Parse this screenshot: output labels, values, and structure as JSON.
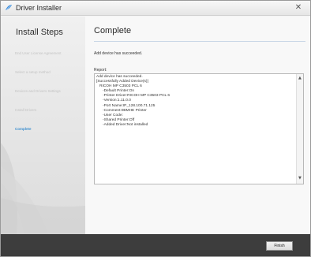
{
  "window": {
    "title": "Driver Installer",
    "close_glyph": "✕",
    "icon": "driver-installer-icon",
    "accent_color": "#3c8fcf"
  },
  "sidebar": {
    "title": "Install Steps",
    "steps": [
      {
        "label": "End User License Agreement",
        "state": "done"
      },
      {
        "label": "Select a setup method",
        "state": "done"
      },
      {
        "label": "Devices and Drivers Settings",
        "state": "done"
      },
      {
        "label": "Install Drivers",
        "state": "done"
      },
      {
        "label": "Complete",
        "state": "active"
      }
    ]
  },
  "main": {
    "title": "Complete",
    "status": "Add device has succeeded.",
    "report_label": "Report:",
    "report_lines": [
      "Add device has succeeded.",
      "",
      "[Successfully Added Device(s)]",
      "   RICOH MP C3503 PCL 6",
      "      -Default Printer:On",
      "      -Printer Driver:RICOH MP C3503 PCL 6",
      "      -Version:1.11.0.0",
      "      -Port Name:IP_128.100.71.125",
      "      -Comment:0BMHE Printer",
      "      -User Code:",
      "      -Shared Printer:Off",
      "      -Added Driver:Not installed"
    ],
    "scroll_up_glyph": "▲",
    "scroll_down_glyph": "▼"
  },
  "footer": {
    "finish_label": "Finish"
  }
}
